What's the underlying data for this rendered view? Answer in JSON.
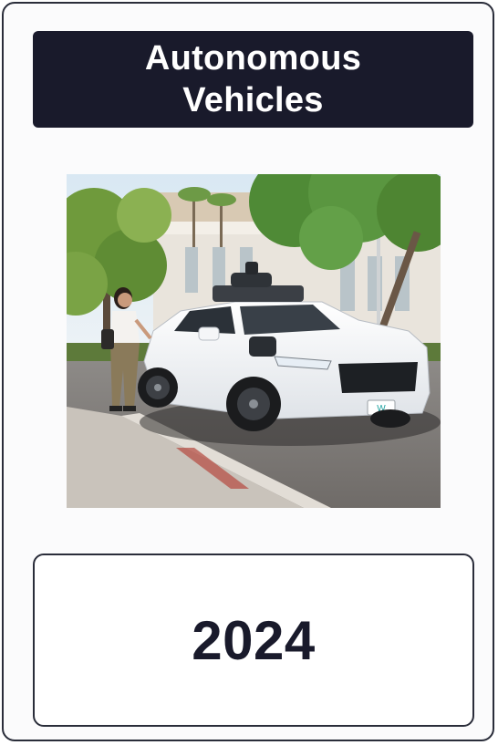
{
  "card": {
    "title": "Autonomous\nVehicles",
    "year": "2024"
  },
  "image": {
    "subject": "white-robotaxi-with-pedestrian",
    "plate_text": "W"
  },
  "colors": {
    "banner": "#191a2b",
    "border": "#2a2d3a",
    "card_bg": "#fbfbfc",
    "title_text": "#ffffff",
    "year_text": "#191a2b"
  }
}
